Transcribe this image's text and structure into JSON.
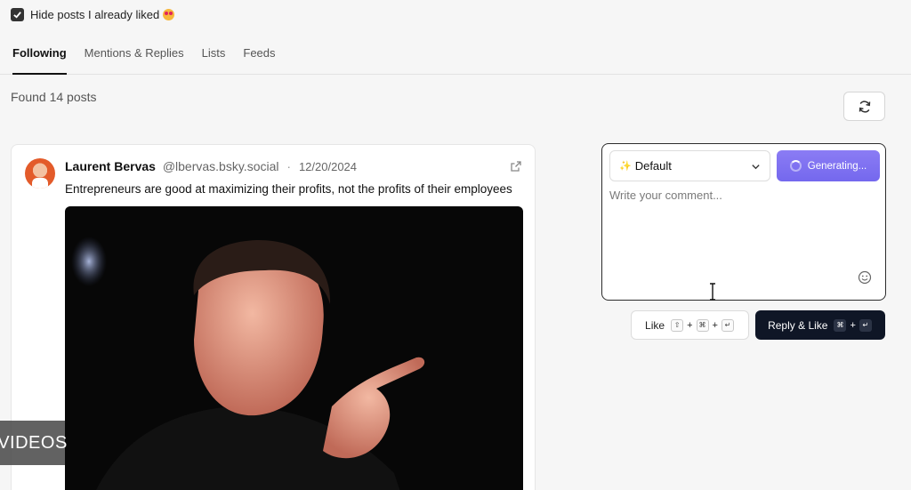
{
  "filter": {
    "label": "Hide posts I already liked",
    "checked": true,
    "emoji": "heart-eyes"
  },
  "tabs": [
    {
      "label": "Following",
      "active": true
    },
    {
      "label": "Mentions & Replies",
      "active": false
    },
    {
      "label": "Lists",
      "active": false
    },
    {
      "label": "Feeds",
      "active": false
    }
  ],
  "found_text": "Found 14 posts",
  "post": {
    "author": "Laurent Bervas",
    "handle": "@lbervas.bsky.social",
    "separator": "·",
    "date": "12/20/2024",
    "text": "Entrepreneurs are good at maximizing their profits, not the profits of their employees",
    "media": "photo"
  },
  "composer": {
    "template_select": "Default",
    "template_icon": "sparkles-icon",
    "generate_label": "Generating...",
    "comment_placeholder": "Write your comment..."
  },
  "actions": {
    "like_label": "Like",
    "like_keys": [
      "⇧",
      "⌘",
      "↵"
    ],
    "reply_like_label": "Reply & Like",
    "reply_keys": [
      "⌘",
      "↵"
    ],
    "plus": "+"
  },
  "overlay": {
    "label": "VIDEOS"
  },
  "colors": {
    "accent": "#7c6ff0",
    "dark_button": "#0f1626"
  }
}
